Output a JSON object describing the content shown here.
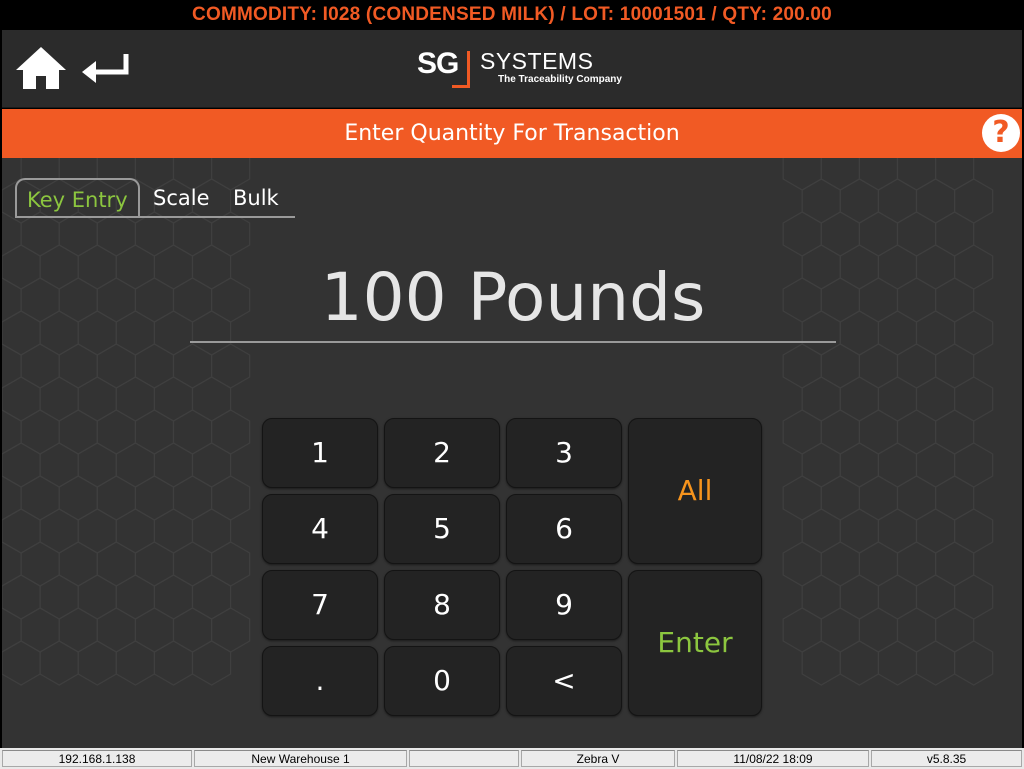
{
  "topbar": {
    "commodity_text": "COMMODITY: I028 (CONDENSED MILK) / LOT: 10001501 / QTY: 200.00"
  },
  "header": {
    "logo": {
      "sg": "SG",
      "word": "SYSTEMS",
      "tagline": "The Traceability Company"
    },
    "home_icon": "home-icon",
    "back_icon": "return-arrow-icon"
  },
  "titlebar": {
    "title": "Enter Quantity For Transaction",
    "help_label": "?"
  },
  "tabs": [
    {
      "label": "Key Entry",
      "active": true
    },
    {
      "label": "Scale",
      "active": false
    },
    {
      "label": "Bulk",
      "active": false
    }
  ],
  "quantity": {
    "display": "100 Pounds"
  },
  "keypad": {
    "keys": [
      "1",
      "2",
      "3",
      "4",
      "5",
      "6",
      "7",
      "8",
      "9",
      ".",
      "0",
      "<"
    ],
    "all_label": "All",
    "enter_label": "Enter"
  },
  "statusbar": {
    "ip": "192.168.1.138",
    "warehouse": "New Warehouse 1",
    "blank": "",
    "printer": "Zebra V",
    "datetime": "11/08/22 18:09",
    "version": "v5.8.35"
  },
  "colors": {
    "accent": "#f15a24",
    "green": "#8cc63f",
    "amber": "#f7941d",
    "panel": "#333333"
  }
}
